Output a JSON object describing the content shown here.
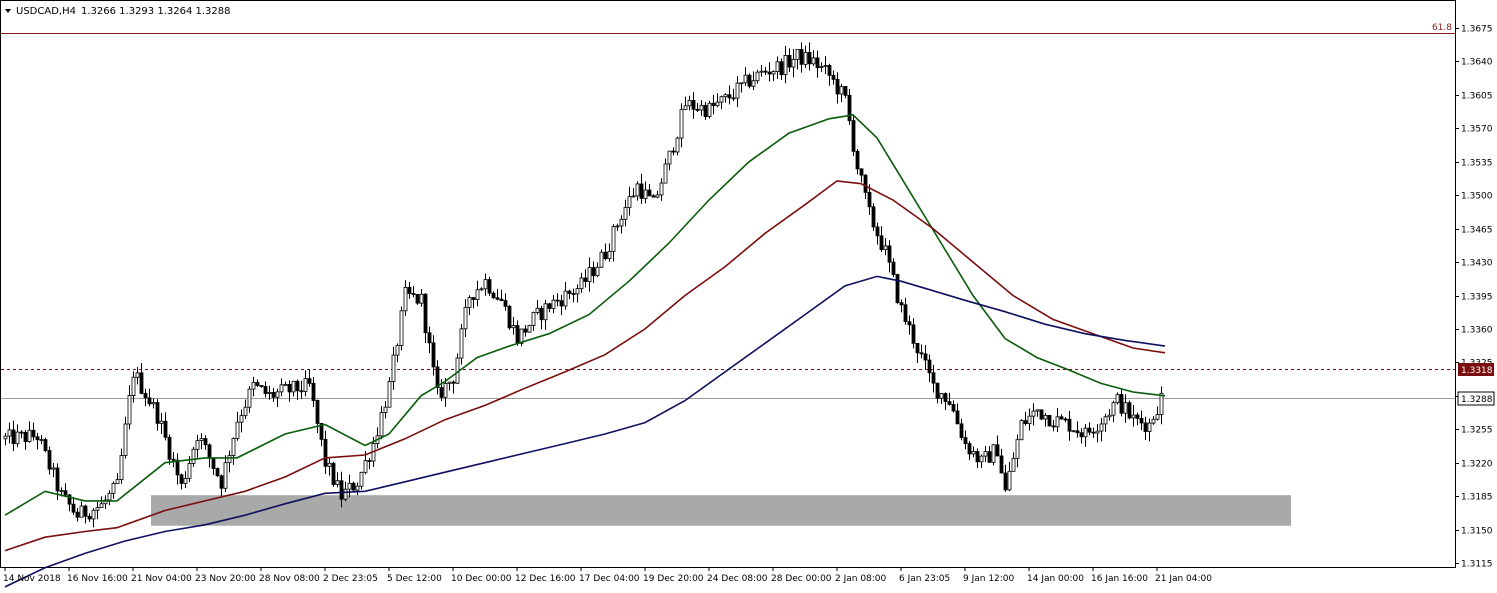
{
  "header": {
    "symbol_timeframe": "USDCAD,H4",
    "ohlc": "1.3266 1.3293 1.3264 1.3288",
    "fibo_label": "61.8"
  },
  "chart_data": {
    "type": "candlestick",
    "symbol": "USDCAD",
    "timeframe": "H4",
    "ylim": [
      1.3115,
      1.369
    ],
    "grid": false,
    "y_ticks": [
      "1.3675",
      "1.3640",
      "1.3605",
      "1.3570",
      "1.3535",
      "1.3500",
      "1.3465",
      "1.3430",
      "1.3395",
      "1.3360",
      "1.3325",
      "1.3290",
      "1.3255",
      "1.3220",
      "1.3185",
      "1.3150",
      "1.3115"
    ],
    "y_tick_values": [
      1.3675,
      1.364,
      1.3605,
      1.357,
      1.3535,
      1.35,
      1.3465,
      1.343,
      1.3395,
      1.336,
      1.3325,
      1.329,
      1.3255,
      1.322,
      1.3185,
      1.315,
      1.3115
    ],
    "x_ticks": [
      "14 Nov 2018",
      "16 Nov 16:00",
      "21 Nov 04:00",
      "23 Nov 20:00",
      "28 Nov 08:00",
      "2 Dec 23:05",
      "5 Dec 12:00",
      "10 Dec 00:00",
      "12 Dec 16:00",
      "17 Dec 04:00",
      "19 Dec 20:00",
      "24 Dec 08:00",
      "28 Dec 00:00",
      "2 Jan 08:00",
      "6 Jan 23:05",
      "9 Jan 12:00",
      "14 Jan 00:00",
      "16 Jan 16:00",
      "21 Jan 04:00"
    ],
    "x_tick_index": [
      0,
      16,
      32,
      48,
      64,
      80,
      96,
      112,
      128,
      144,
      160,
      176,
      192,
      208,
      224,
      240,
      256,
      272,
      288
    ],
    "bar_count": 290,
    "close_path": [
      [
        0,
        1.3245
      ],
      [
        8,
        1.3248
      ],
      [
        14,
        1.3185
      ],
      [
        18,
        1.3165
      ],
      [
        24,
        1.3175
      ],
      [
        28,
        1.3195
      ],
      [
        32,
        1.3315
      ],
      [
        38,
        1.327
      ],
      [
        44,
        1.3195
      ],
      [
        48,
        1.325
      ],
      [
        54,
        1.32
      ],
      [
        58,
        1.3265
      ],
      [
        62,
        1.33
      ],
      [
        66,
        1.329
      ],
      [
        70,
        1.3295
      ],
      [
        76,
        1.33
      ],
      [
        80,
        1.322
      ],
      [
        84,
        1.3185
      ],
      [
        88,
        1.32
      ],
      [
        92,
        1.324
      ],
      [
        96,
        1.33
      ],
      [
        100,
        1.3395
      ],
      [
        104,
        1.339
      ],
      [
        108,
        1.329
      ],
      [
        112,
        1.331
      ],
      [
        116,
        1.3395
      ],
      [
        120,
        1.341
      ],
      [
        124,
        1.339
      ],
      [
        128,
        1.335
      ],
      [
        132,
        1.337
      ],
      [
        136,
        1.3385
      ],
      [
        140,
        1.3395
      ],
      [
        144,
        1.3405
      ],
      [
        150,
        1.344
      ],
      [
        154,
        1.348
      ],
      [
        158,
        1.351
      ],
      [
        162,
        1.349
      ],
      [
        166,
        1.354
      ],
      [
        170,
        1.3595
      ],
      [
        176,
        1.359
      ],
      [
        180,
        1.36
      ],
      [
        186,
        1.362
      ],
      [
        190,
        1.363
      ],
      [
        194,
        1.3635
      ],
      [
        198,
        1.3645
      ],
      [
        202,
        1.364
      ],
      [
        206,
        1.3625
      ],
      [
        210,
        1.36
      ],
      [
        213,
        1.353
      ],
      [
        216,
        1.348
      ],
      [
        220,
        1.344
      ],
      [
        224,
        1.338
      ],
      [
        228,
        1.334
      ],
      [
        232,
        1.33
      ],
      [
        236,
        1.3285
      ],
      [
        240,
        1.324
      ],
      [
        244,
        1.322
      ],
      [
        248,
        1.3235
      ],
      [
        250,
        1.319
      ],
      [
        254,
        1.326
      ],
      [
        258,
        1.3275
      ],
      [
        262,
        1.3265
      ],
      [
        266,
        1.326
      ],
      [
        270,
        1.325
      ],
      [
        274,
        1.3265
      ],
      [
        278,
        1.3285
      ],
      [
        282,
        1.3265
      ],
      [
        286,
        1.326
      ],
      [
        289,
        1.3288
      ]
    ],
    "series": [
      {
        "name": "",
        "color": "#0a5c0a",
        "points": [
          [
            0,
            1.3165
          ],
          [
            10,
            1.319
          ],
          [
            20,
            1.318
          ],
          [
            28,
            1.318
          ],
          [
            40,
            1.322
          ],
          [
            50,
            1.3225
          ],
          [
            58,
            1.3225
          ],
          [
            70,
            1.325
          ],
          [
            80,
            1.326
          ],
          [
            90,
            1.3238
          ],
          [
            96,
            1.325
          ],
          [
            104,
            1.329
          ],
          [
            110,
            1.3305
          ],
          [
            118,
            1.333
          ],
          [
            126,
            1.3342
          ],
          [
            136,
            1.3355
          ],
          [
            146,
            1.3375
          ],
          [
            156,
            1.341
          ],
          [
            166,
            1.345
          ],
          [
            176,
            1.3495
          ],
          [
            186,
            1.3535
          ],
          [
            196,
            1.3565
          ],
          [
            206,
            1.358
          ],
          [
            212,
            1.3584
          ],
          [
            218,
            1.356
          ],
          [
            226,
            1.3505
          ],
          [
            234,
            1.345
          ],
          [
            242,
            1.3395
          ],
          [
            250,
            1.335
          ],
          [
            258,
            1.333
          ],
          [
            266,
            1.3317
          ],
          [
            274,
            1.3303
          ],
          [
            282,
            1.3294
          ],
          [
            290,
            1.329
          ]
        ]
      },
      {
        "name": "",
        "color": "#7a0d0d",
        "points": [
          [
            0,
            1.3128
          ],
          [
            10,
            1.3142
          ],
          [
            20,
            1.3148
          ],
          [
            28,
            1.3152
          ],
          [
            40,
            1.317
          ],
          [
            50,
            1.318
          ],
          [
            60,
            1.319
          ],
          [
            70,
            1.3205
          ],
          [
            80,
            1.3225
          ],
          [
            90,
            1.3228
          ],
          [
            100,
            1.3245
          ],
          [
            110,
            1.3265
          ],
          [
            120,
            1.328
          ],
          [
            130,
            1.3298
          ],
          [
            140,
            1.3315
          ],
          [
            150,
            1.3333
          ],
          [
            160,
            1.336
          ],
          [
            170,
            1.3395
          ],
          [
            180,
            1.3425
          ],
          [
            190,
            1.346
          ],
          [
            200,
            1.349
          ],
          [
            208,
            1.3515
          ],
          [
            214,
            1.3512
          ],
          [
            222,
            1.3495
          ],
          [
            232,
            1.3465
          ],
          [
            242,
            1.343
          ],
          [
            252,
            1.3395
          ],
          [
            262,
            1.337
          ],
          [
            272,
            1.3355
          ],
          [
            282,
            1.334
          ],
          [
            290,
            1.3335
          ]
        ]
      },
      {
        "name": "",
        "color": "#101060",
        "points": [
          [
            0,
            1.309
          ],
          [
            10,
            1.311
          ],
          [
            20,
            1.3125
          ],
          [
            30,
            1.3138
          ],
          [
            40,
            1.3148
          ],
          [
            50,
            1.3155
          ],
          [
            60,
            1.3165
          ],
          [
            70,
            1.3177
          ],
          [
            80,
            1.3188
          ],
          [
            90,
            1.319
          ],
          [
            100,
            1.32
          ],
          [
            110,
            1.321
          ],
          [
            120,
            1.322
          ],
          [
            130,
            1.323
          ],
          [
            140,
            1.324
          ],
          [
            150,
            1.325
          ],
          [
            160,
            1.3262
          ],
          [
            170,
            1.3285
          ],
          [
            180,
            1.3315
          ],
          [
            190,
            1.3345
          ],
          [
            200,
            1.3375
          ],
          [
            210,
            1.3405
          ],
          [
            218,
            1.3415
          ],
          [
            224,
            1.341
          ],
          [
            232,
            1.34
          ],
          [
            240,
            1.339
          ],
          [
            250,
            1.3378
          ],
          [
            260,
            1.3365
          ],
          [
            270,
            1.3355
          ],
          [
            280,
            1.3348
          ],
          [
            290,
            1.3342
          ]
        ]
      }
    ],
    "horizontal_levels": [
      {
        "label": "61.8",
        "value": 1.367,
        "color": "#8b1a1a",
        "style": "solid"
      },
      {
        "label": "1.3318",
        "value": 1.3318,
        "color": "#7a0d0d",
        "style": "dashed"
      },
      {
        "label": "1.3288",
        "value": 1.3288,
        "color": "#9a9a9a",
        "style": "solid"
      }
    ],
    "zone": {
      "from_index": 37,
      "to_index": 322,
      "low": 1.3154,
      "high": 1.3186,
      "color": "#a9a9a9"
    },
    "markers": {
      "current_price": "1.3288",
      "level_price": "1.3318"
    }
  }
}
